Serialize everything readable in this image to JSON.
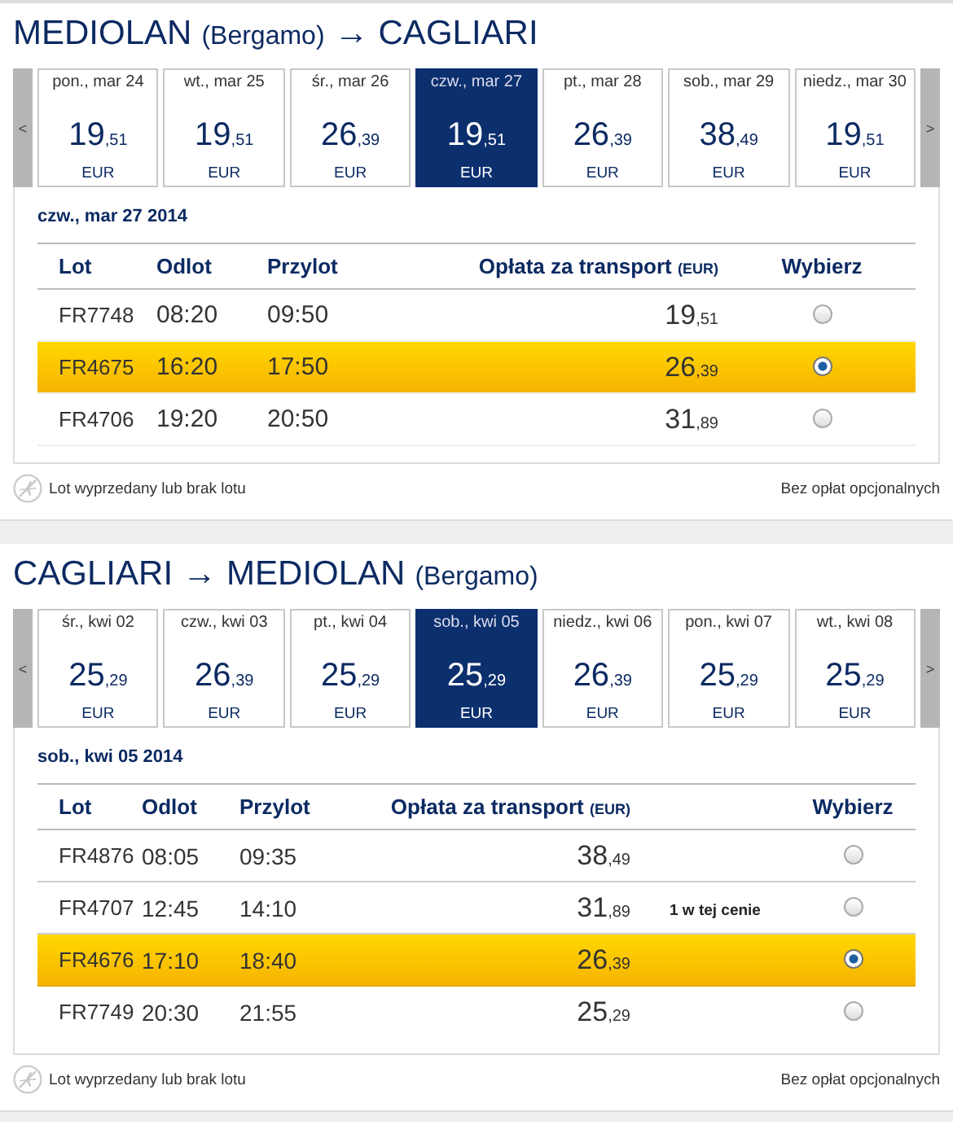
{
  "journeys": [
    {
      "title": [
        {
          "kind": "city",
          "text": "MEDIOLAN"
        },
        {
          "kind": "airport",
          "text": "(Bergamo)"
        },
        {
          "kind": "arrow",
          "text": "→"
        },
        {
          "kind": "city",
          "text": "CAGLIARI"
        }
      ],
      "prev": "<",
      "next": ">",
      "days": [
        {
          "date": "pon., mar 24",
          "whole": "19",
          "cents": ",51",
          "currency": "EUR",
          "selected": false
        },
        {
          "date": "wt., mar 25",
          "whole": "19",
          "cents": ",51",
          "currency": "EUR",
          "selected": false
        },
        {
          "date": "śr., mar 26",
          "whole": "26",
          "cents": ",39",
          "currency": "EUR",
          "selected": false
        },
        {
          "date": "czw., mar 27",
          "whole": "19",
          "cents": ",51",
          "currency": "EUR",
          "selected": true
        },
        {
          "date": "pt., mar 28",
          "whole": "26",
          "cents": ",39",
          "currency": "EUR",
          "selected": false
        },
        {
          "date": "sob., mar 29",
          "whole": "38",
          "cents": ",49",
          "currency": "EUR",
          "selected": false
        },
        {
          "date": "niedz., mar 30",
          "whole": "19",
          "cents": ",51",
          "currency": "EUR",
          "selected": false
        }
      ],
      "selected_date": "czw., mar 27 2014",
      "columns": {
        "flight": "Lot",
        "departure": "Odlot",
        "arrival": "Przylot",
        "fare": "Opłata za transport",
        "fare_unit": "(EUR)",
        "select": "Wybierz"
      },
      "flights": [
        {
          "flight": "FR7748",
          "departure": "08:20",
          "arrival": "09:50",
          "whole": "19",
          "cents": ",51",
          "selected": false
        },
        {
          "flight": "FR4675",
          "departure": "16:20",
          "arrival": "17:50",
          "whole": "26",
          "cents": ",39",
          "selected": true
        },
        {
          "flight": "FR4706",
          "departure": "19:20",
          "arrival": "20:50",
          "whole": "31",
          "cents": ",89",
          "selected": false
        }
      ],
      "legend": "Lot wyprzedany lub brak lotu",
      "fees_note": "Bez opłat opcjonalnych"
    },
    {
      "title": [
        {
          "kind": "city",
          "text": "CAGLIARI"
        },
        {
          "kind": "arrow",
          "text": "→"
        },
        {
          "kind": "city",
          "text": "MEDIOLAN"
        },
        {
          "kind": "airport",
          "text": "(Bergamo)"
        }
      ],
      "prev": "<",
      "next": ">",
      "days": [
        {
          "date": "śr., kwi 02",
          "whole": "25",
          "cents": ",29",
          "currency": "EUR",
          "selected": false
        },
        {
          "date": "czw., kwi 03",
          "whole": "26",
          "cents": ",39",
          "currency": "EUR",
          "selected": false
        },
        {
          "date": "pt., kwi 04",
          "whole": "25",
          "cents": ",29",
          "currency": "EUR",
          "selected": false
        },
        {
          "date": "sob., kwi 05",
          "whole": "25",
          "cents": ",29",
          "currency": "EUR",
          "selected": true
        },
        {
          "date": "niedz., kwi 06",
          "whole": "26",
          "cents": ",39",
          "currency": "EUR",
          "selected": false
        },
        {
          "date": "pon., kwi 07",
          "whole": "25",
          "cents": ",29",
          "currency": "EUR",
          "selected": false
        },
        {
          "date": "wt., kwi 08",
          "whole": "25",
          "cents": ",29",
          "currency": "EUR",
          "selected": false
        }
      ],
      "selected_date": "sob., kwi 05 2014",
      "columns": {
        "flight": "Lot",
        "departure": "Odlot",
        "arrival": "Przylot",
        "fare": "Opłata za transport",
        "fare_unit": "(EUR)",
        "select": "Wybierz"
      },
      "flights": [
        {
          "flight": "FR4876",
          "departure": "08:05",
          "arrival": "09:35",
          "whole": "38",
          "cents": ",49",
          "selected": false
        },
        {
          "flight": "FR4707",
          "departure": "12:45",
          "arrival": "14:10",
          "whole": "31",
          "cents": ",89",
          "note": "1 w tej cenie",
          "selected": false
        },
        {
          "flight": "FR4676",
          "departure": "17:10",
          "arrival": "18:40",
          "whole": "26",
          "cents": ",39",
          "selected": true
        },
        {
          "flight": "FR7749",
          "departure": "20:30",
          "arrival": "21:55",
          "whole": "25",
          "cents": ",29",
          "selected": false
        }
      ],
      "legend": "Lot wyprzedany lub brak lotu",
      "fees_note": "Bez opłat opcjonalnych"
    }
  ]
}
